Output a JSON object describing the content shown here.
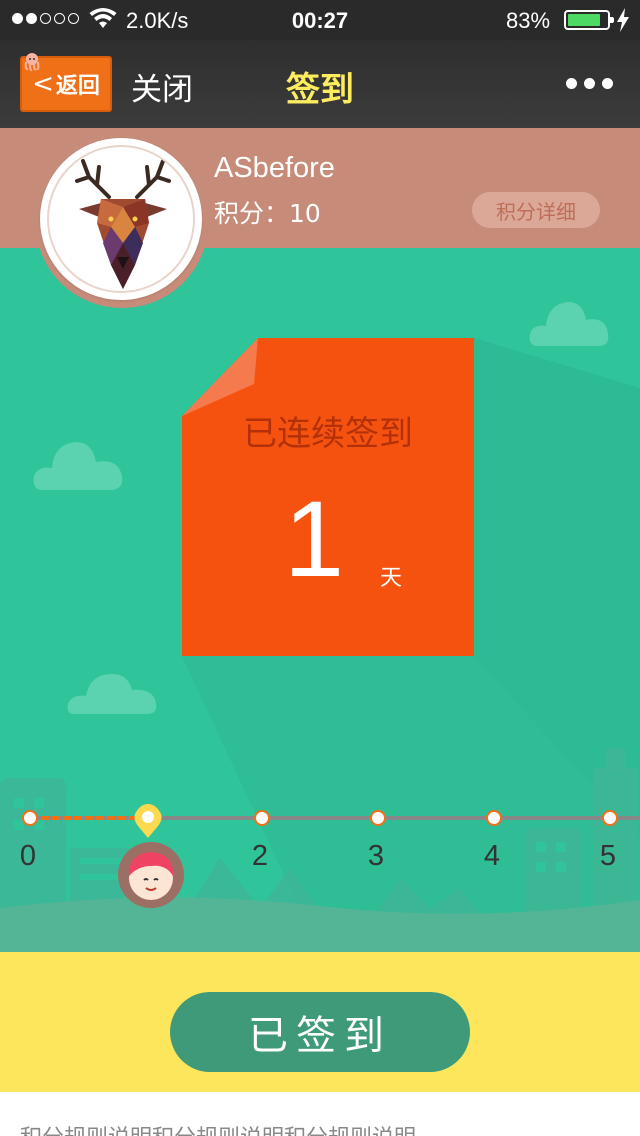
{
  "status_bar": {
    "signal_dots": [
      true,
      true,
      false,
      false,
      false
    ],
    "network_speed": "2.0K/s",
    "time": "00:27",
    "battery_percent": "83%",
    "battery_level": 0.83
  },
  "nav": {
    "back_label": "返回",
    "close_label": "关闭",
    "title": "签到",
    "title_color": "#fcec5e",
    "more_icon": "ellipsis-icon"
  },
  "profile": {
    "username": "ASbefore",
    "points_label": "积分：",
    "points_value": "10",
    "points_detail_button": "积分详细",
    "avatar_icon": "deer-head-icon"
  },
  "streak_card": {
    "label": "已连续签到",
    "days": "1",
    "unit": "天",
    "color": "#f5520f"
  },
  "progress": {
    "marker_labels": [
      "0",
      "2",
      "3",
      "4",
      "5"
    ],
    "current_day": 1,
    "accent": "#f07017"
  },
  "action": {
    "signed_button": "已签到",
    "button_color": "#3e9a78"
  },
  "rules_text": "积分规则说明积分规则说明积分规则说明"
}
